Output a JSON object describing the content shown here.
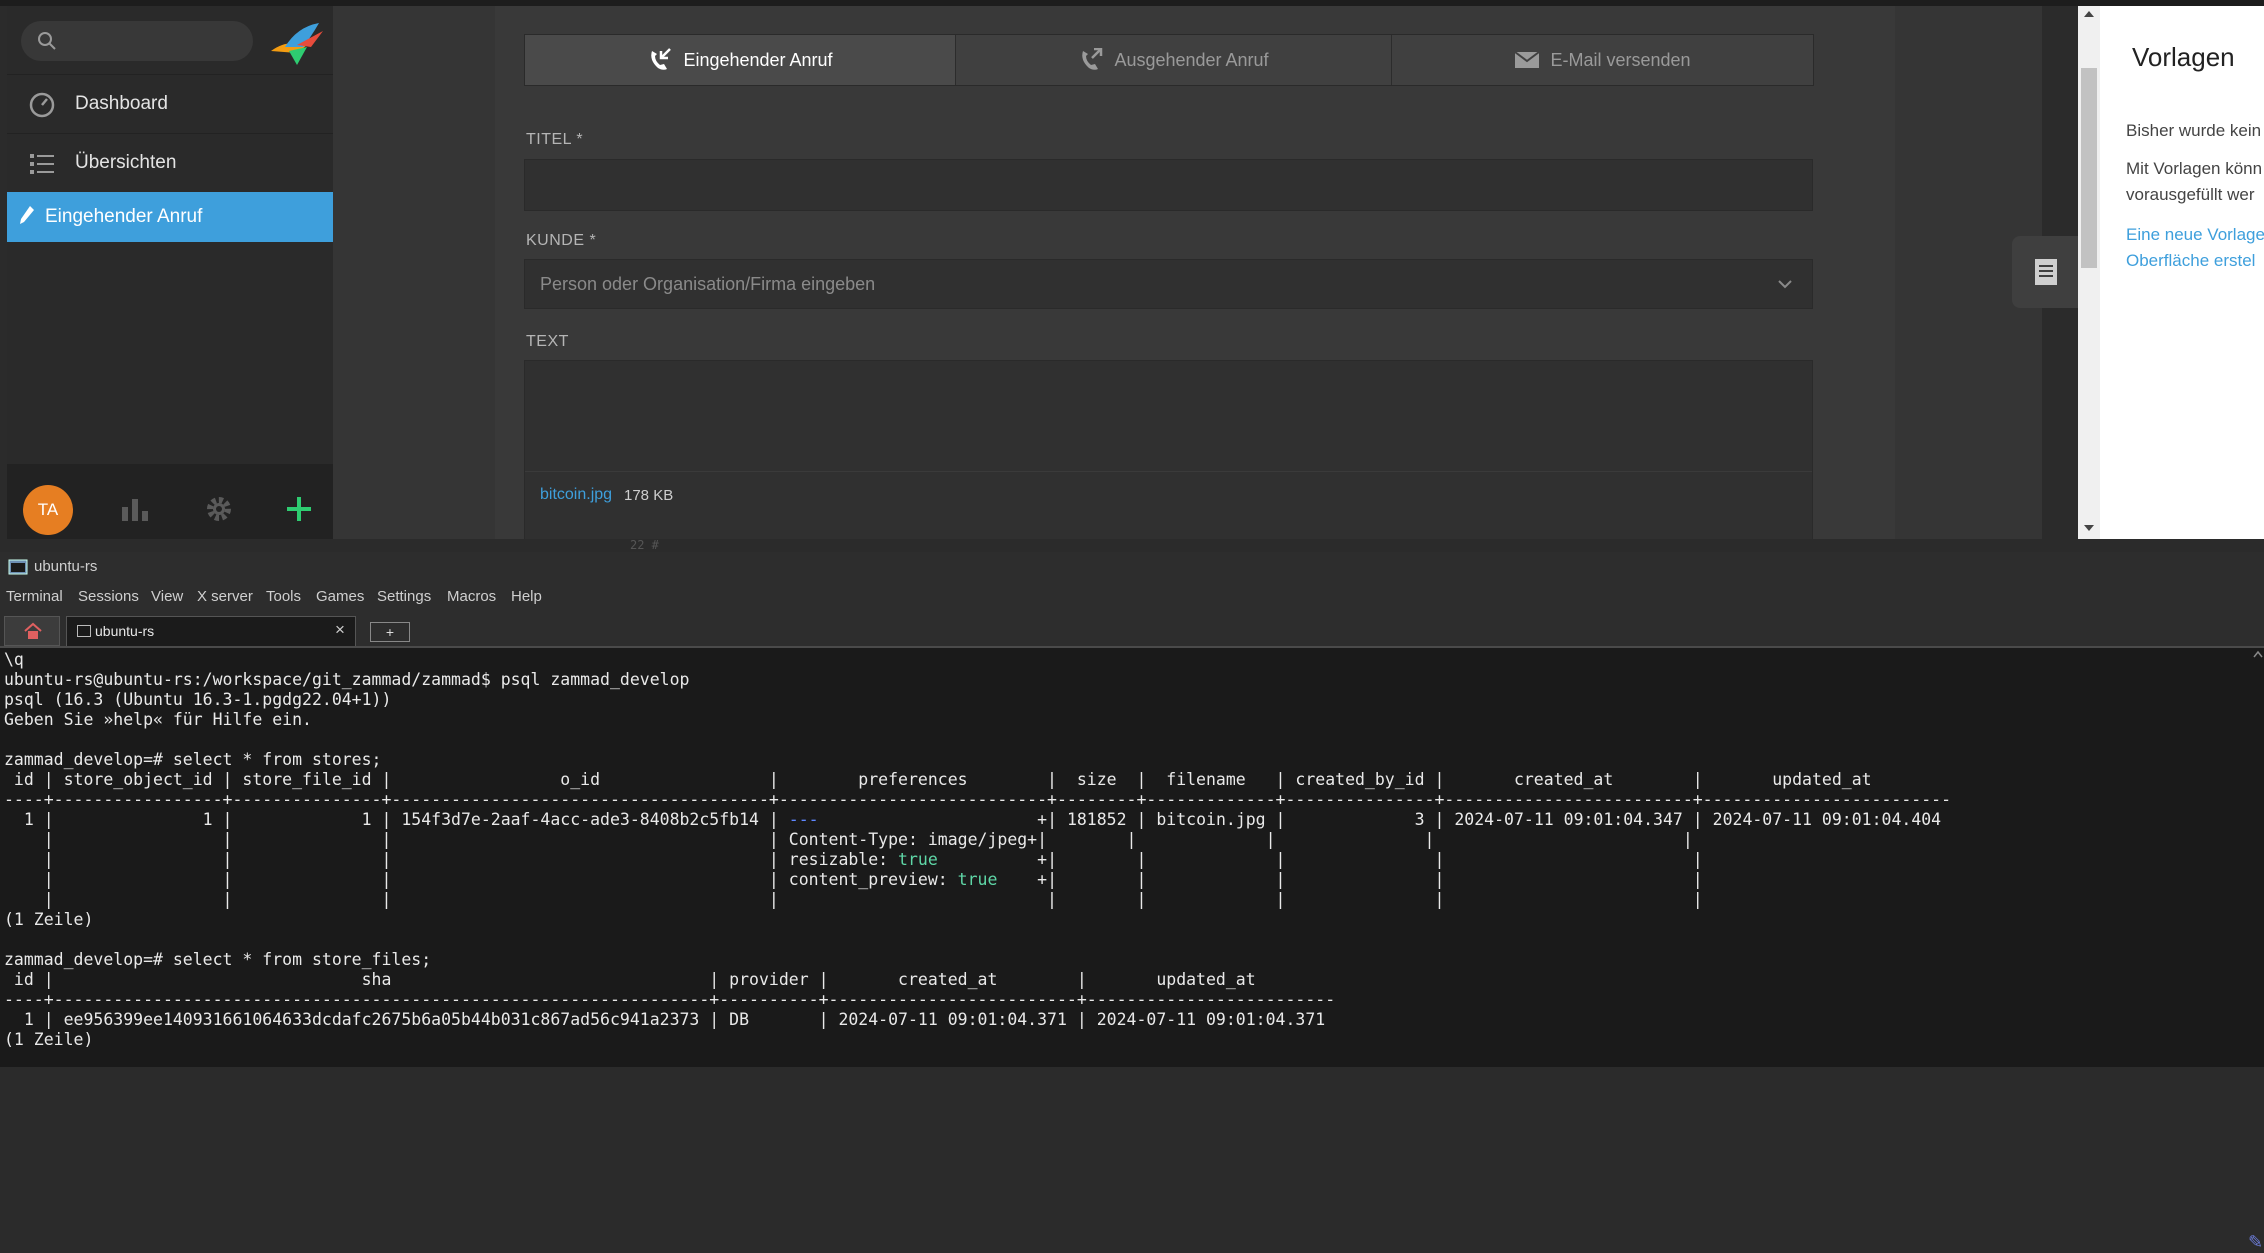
{
  "sidebar": {
    "search_placeholder": "",
    "items": [
      {
        "label": "Dashboard",
        "icon": "dashboard-icon"
      },
      {
        "label": "Übersichten",
        "icon": "list-icon"
      },
      {
        "label": "Eingehender Anruf",
        "icon": "pencil-icon",
        "active": true
      }
    ],
    "avatar_initials": "TA"
  },
  "form": {
    "tabs": [
      {
        "label": "Eingehender Anruf",
        "icon": "phone-incoming-icon",
        "active": true
      },
      {
        "label": "Ausgehender Anruf",
        "icon": "phone-outgoing-icon"
      },
      {
        "label": "E-Mail versenden",
        "icon": "envelope-icon"
      }
    ],
    "title_label": "TITEL *",
    "title_value": "",
    "customer_label": "KUNDE *",
    "customer_placeholder": "Person oder Organisation/Firma eingeben",
    "text_label": "TEXT",
    "attachment": {
      "name": "bitcoin.jpg",
      "size": "178 KB"
    }
  },
  "right_panel": {
    "title": "Vorlagen",
    "line1": "Bisher wurde kein",
    "line2a": "Mit Vorlagen könn",
    "line2b": "vorausgefüllt wer",
    "link_a": "Eine neue Vorlage",
    "link_b": "Oberfläche erstel"
  },
  "bleed_text": "22    #",
  "terminal_window": {
    "title": "ubuntu-rs",
    "menu": [
      "Terminal",
      "Sessions",
      "View",
      "X server",
      "Tools",
      "Games",
      "Settings",
      "Macros",
      "Help"
    ],
    "tab_label": "ubuntu-rs",
    "tab_close": "×",
    "add_tab": "+"
  },
  "terminal": {
    "lines": [
      "\\q",
      "ubuntu-rs@ubuntu-rs:/workspace/git_zammad/zammad$ psql zammad_develop",
      "psql (16.3 (Ubuntu 16.3-1.pgdg22.04+1))",
      "Geben Sie »help« für Hilfe ein.",
      "",
      "zammad_develop=# select * from stores;",
      " id | store_object_id | store_file_id |                 o_id                 |        preferences        |  size  |  filename   | created_by_id |       created_at        |       updated_at",
      "----+-----------------+---------------+--------------------------------------+---------------------------+--------+-------------+---------------+-------------------------+-------------------------",
      "  1 |               1 |             1 | 154f3d7e-2aaf-4acc-ade3-8408b2c5fb14 | ---                      +| 181852 | bitcoin.jpg |             3 | 2024-07-11 09:01:04.347 | 2024-07-11 09:01:04.404",
      "    |                 |               |                                      | Content-Type: image/jpeg+|        |             |               |                         |",
      "    |                 |               |                                      | resizable: true          +|        |             |               |                         |",
      "    |                 |               |                                      | content_preview: true    +|        |             |               |                         |",
      "    |                 |               |                                      |                           |        |             |               |                         |",
      "(1 Zeile)",
      "",
      "zammad_develop=# select * from store_files;",
      " id |                               sha                                | provider |       created_at        |       updated_at",
      "----+------------------------------------------------------------------+----------+-------------------------+-------------------------",
      "  1 | ee956399ee140931661064633dcdafc2675b6a05b44b031c867ad56c941a2373 | DB       | 2024-07-11 09:01:04.371 | 2024-07-11 09:01:04.371",
      "(1 Zeile)"
    ]
  },
  "colors": {
    "accent": "#3e9fdc",
    "avatar": "#e67e22",
    "add_button": "#2ecc71",
    "yaml_marker": "#5f87ff",
    "yaml_true": "#5fd7a7"
  }
}
